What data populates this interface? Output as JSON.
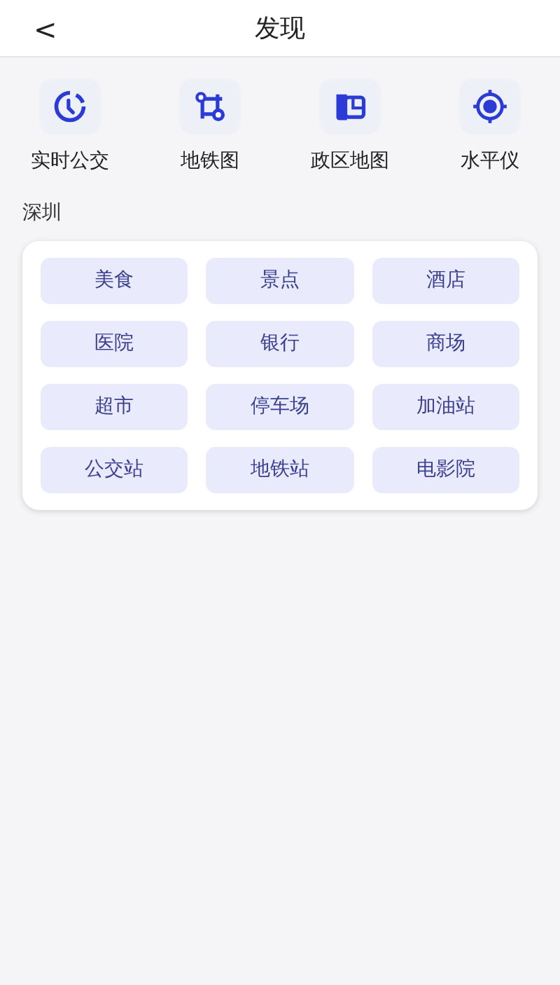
{
  "header": {
    "back": "<",
    "title": "发现"
  },
  "tools": [
    {
      "label": "实时公交"
    },
    {
      "label": "地铁图"
    },
    {
      "label": "政区地图"
    },
    {
      "label": "水平仪"
    }
  ],
  "city": "深圳",
  "categories": [
    "美食",
    "景点",
    "酒店",
    "医院",
    "银行",
    "商场",
    "超市",
    "停车场",
    "加油站",
    "公交站",
    "地铁站",
    "电影院"
  ]
}
